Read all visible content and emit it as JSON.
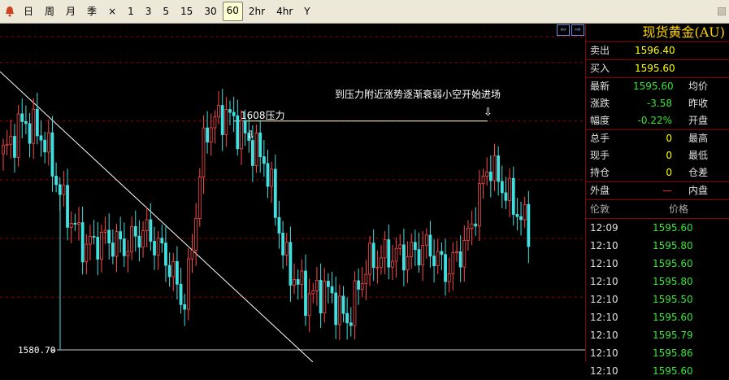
{
  "toolbar": {
    "periods": [
      "日",
      "周",
      "月",
      "季",
      "×",
      "1",
      "3",
      "5",
      "15",
      "30",
      "60",
      "2hr",
      "4hr",
      "Y"
    ],
    "active": "60"
  },
  "chart": {
    "annotation_resistance": "1608压力",
    "annotation_main": "到压力附近涨势逐渐衰弱小空开始进场",
    "low_label": "1580.70"
  },
  "chart_data": {
    "type": "candlestick",
    "annotations": [
      "1608压力",
      "到压力附近涨势逐渐衰弱小空开始进场"
    ],
    "price_labels": [
      "1580.70"
    ],
    "resistance_level": 1608,
    "low": 1580.7,
    "approx_closes": [
      1604,
      1608,
      1606,
      1598,
      1593,
      1594,
      1593,
      1595,
      1592,
      1586,
      1607,
      1609,
      1606,
      1603,
      1591,
      1587,
      1588,
      1584,
      1591,
      1592,
      1592,
      1593,
      1590,
      1594,
      1603,
      1599,
      1595
    ]
  },
  "panel": {
    "title": "现货黄金(AU)",
    "sell_label": "卖出",
    "sell_value": "1596.40",
    "buy_label": "买入",
    "buy_value": "1595.60",
    "rows": [
      {
        "label": "最新",
        "value": "1595.60",
        "right": "均价"
      },
      {
        "label": "涨跌",
        "value": "-3.58",
        "right": "昨收"
      },
      {
        "label": "幅度",
        "value": "-0.22%",
        "right": "开盘"
      },
      {
        "label": "总手",
        "value": "0",
        "right": "最高"
      },
      {
        "label": "现手",
        "value": "0",
        "right": "最低"
      },
      {
        "label": "持仓",
        "value": "0",
        "right": "仓差"
      }
    ],
    "outer_label": "外盘",
    "outer_value": "—",
    "inner_label": "内盘",
    "ticks_col_time": "伦敦",
    "ticks_col_price": "价格",
    "ticks": [
      {
        "time": "12:09",
        "price": "1595.60"
      },
      {
        "time": "12:10",
        "price": "1595.80"
      },
      {
        "time": "12:10",
        "price": "1595.60"
      },
      {
        "time": "12:10",
        "price": "1595.80"
      },
      {
        "time": "12:10",
        "price": "1595.50"
      },
      {
        "time": "12:10",
        "price": "1595.60"
      },
      {
        "time": "12:10",
        "price": "1595.79"
      },
      {
        "time": "12:10",
        "price": "1595.86"
      },
      {
        "time": "12:10",
        "price": "1595.60"
      }
    ]
  }
}
